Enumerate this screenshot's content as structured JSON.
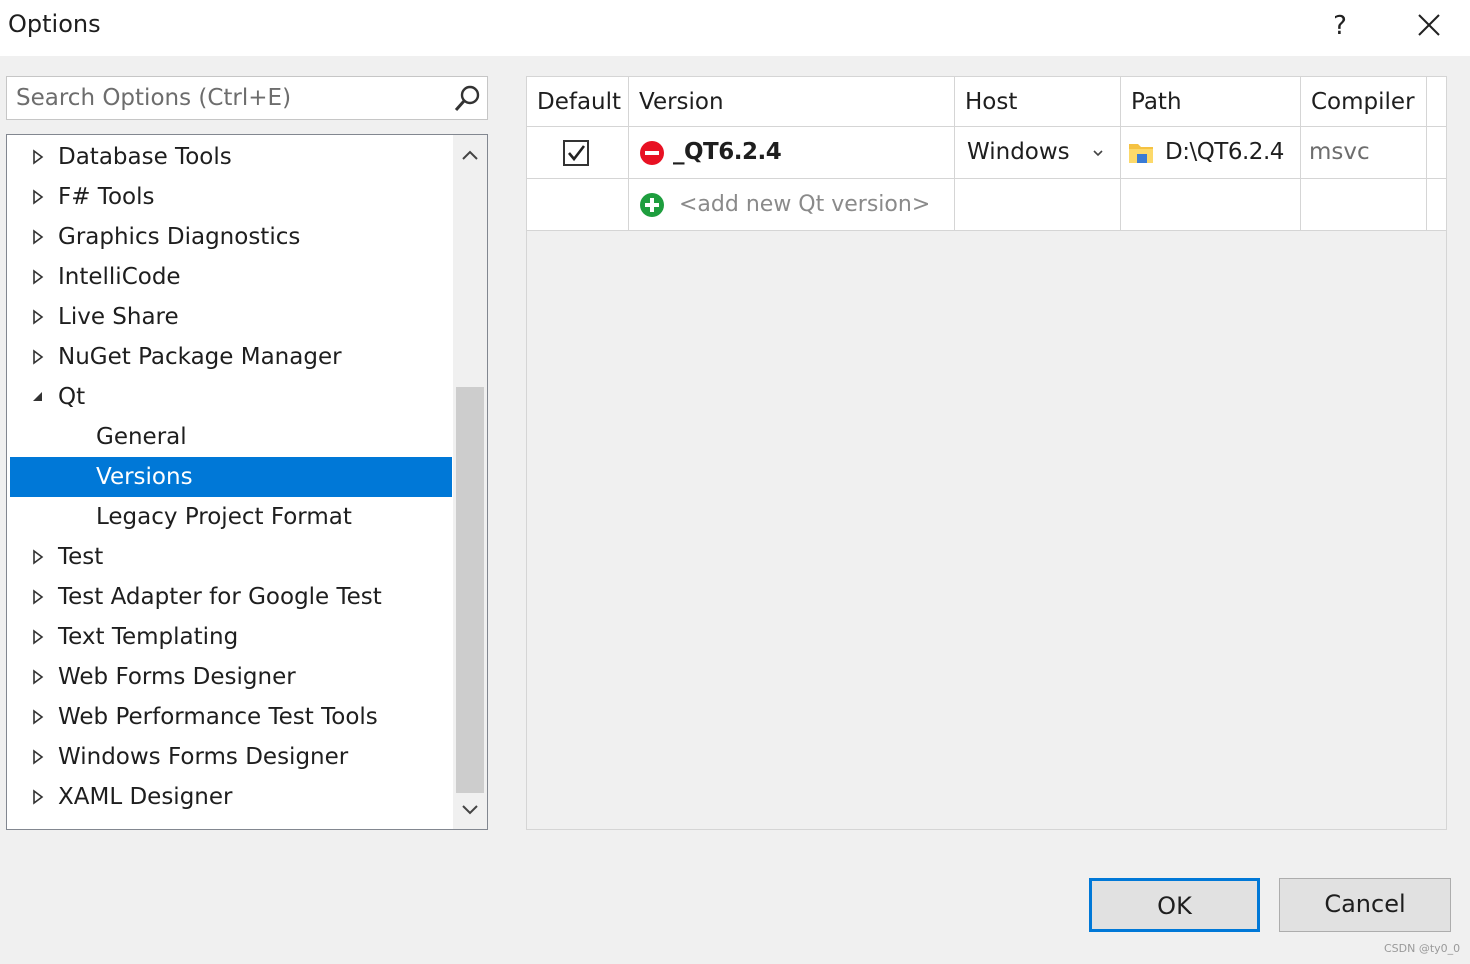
{
  "window": {
    "title": "Options",
    "help_glyph": "?"
  },
  "search": {
    "placeholder": "Search Options (Ctrl+E)",
    "value": ""
  },
  "tree": {
    "items": [
      {
        "label": "Database Tools",
        "level": 0,
        "expander": "collapsed"
      },
      {
        "label": "F# Tools",
        "level": 0,
        "expander": "collapsed"
      },
      {
        "label": "Graphics Diagnostics",
        "level": 0,
        "expander": "collapsed"
      },
      {
        "label": "IntelliCode",
        "level": 0,
        "expander": "collapsed"
      },
      {
        "label": "Live Share",
        "level": 0,
        "expander": "collapsed"
      },
      {
        "label": "NuGet Package Manager",
        "level": 0,
        "expander": "collapsed"
      },
      {
        "label": "Qt",
        "level": 0,
        "expander": "expanded"
      },
      {
        "label": "General",
        "level": 1,
        "expander": "none"
      },
      {
        "label": "Versions",
        "level": 1,
        "expander": "none",
        "selected": true
      },
      {
        "label": "Legacy Project Format",
        "level": 1,
        "expander": "none"
      },
      {
        "label": "Test",
        "level": 0,
        "expander": "collapsed"
      },
      {
        "label": "Test Adapter for Google Test",
        "level": 0,
        "expander": "collapsed"
      },
      {
        "label": "Text Templating",
        "level": 0,
        "expander": "collapsed"
      },
      {
        "label": "Web Forms Designer",
        "level": 0,
        "expander": "collapsed"
      },
      {
        "label": "Web Performance Test Tools",
        "level": 0,
        "expander": "collapsed"
      },
      {
        "label": "Windows Forms Designer",
        "level": 0,
        "expander": "collapsed"
      },
      {
        "label": "XAML Designer",
        "level": 0,
        "expander": "collapsed"
      }
    ]
  },
  "grid": {
    "columns": [
      "Default",
      "Version",
      "Host",
      "Path",
      "Compiler"
    ],
    "rows": [
      {
        "default_checked": true,
        "version": "_QT6.2.4",
        "host": "Windows",
        "path": "D:\\QT6.2.4",
        "compiler": "msvc"
      }
    ],
    "add_row_label": "<add new Qt version>"
  },
  "buttons": {
    "ok": "OK",
    "cancel": "Cancel"
  },
  "watermark": "CSDN @ty0_0",
  "colors": {
    "accent": "#0078d7",
    "remove_icon": "#e81123",
    "add_icon": "#1e9e3e",
    "folder_icon": "#f5c242"
  },
  "icons": {
    "search": "search-icon",
    "remove": "remove-circle-icon",
    "add": "add-circle-icon",
    "folder": "folder-icon",
    "dropdown": "chevron-down-icon",
    "close": "close-icon"
  }
}
